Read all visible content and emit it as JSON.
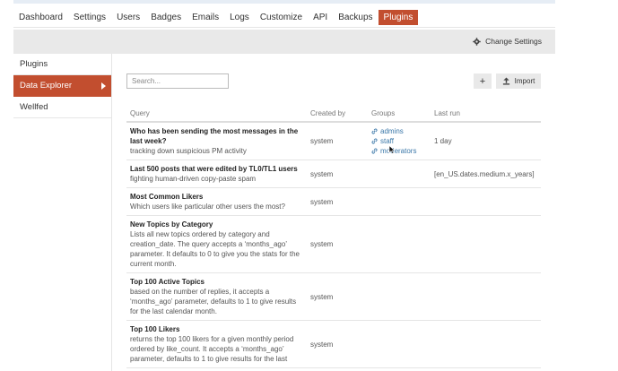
{
  "nav": {
    "items": [
      "Dashboard",
      "Settings",
      "Users",
      "Badges",
      "Emails",
      "Logs",
      "Customize",
      "API",
      "Backups",
      "Plugins"
    ],
    "active": "Plugins"
  },
  "settings_bar": {
    "change_settings_label": "Change Settings",
    "icon": "gear-icon"
  },
  "sidebar": {
    "items": [
      {
        "label": "Plugins",
        "active": false
      },
      {
        "label": "Data Explorer",
        "active": true
      },
      {
        "label": "Wellfed",
        "active": false
      }
    ]
  },
  "search": {
    "placeholder": "Search...",
    "value": ""
  },
  "buttons": {
    "add_label": "+",
    "import_label": "Import"
  },
  "table": {
    "headers": {
      "query": "Query",
      "created_by": "Created by",
      "groups": "Groups",
      "last_run": "Last run"
    },
    "rows": [
      {
        "name": "Who has been sending the most messages in the last week?",
        "description": "tracking down suspicious PM activity",
        "created_by": "system",
        "groups": [
          "admins",
          "staff",
          "moderators"
        ],
        "last_run": "1 day"
      },
      {
        "name": "Last 500 posts that were edited by TL0/TL1 users",
        "description": "fighting human-driven copy-paste spam",
        "created_by": "system",
        "groups": [],
        "last_run": "[en_US.dates.medium.x_years]"
      },
      {
        "name": "Most Common Likers",
        "description": "Which users like particular other users the most?",
        "created_by": "system",
        "groups": [],
        "last_run": ""
      },
      {
        "name": "New Topics by Category",
        "description": "Lists all new topics ordered by category and creation_date. The query accepts a ‘months_ago’ parameter. It defaults to 0 to give you the stats for the current month.",
        "created_by": "system",
        "groups": [],
        "last_run": ""
      },
      {
        "name": "Top 100 Active Topics",
        "description": "based on the number of replies, it accepts a ‘months_ago’ parameter, defaults to 1 to give results for the last calendar month.",
        "created_by": "system",
        "groups": [],
        "last_run": ""
      },
      {
        "name": "Top 100 Likers",
        "description": "returns the top 100 likers for a given monthly period ordered by like_count. It accepts a ‘months_ago’ parameter, defaults to 1 to give results for the last",
        "created_by": "system",
        "groups": [],
        "last_run": ""
      }
    ]
  },
  "colors": {
    "accent": "#c24e2f",
    "link": "#3a77a8",
    "bar": "#e9e9e9"
  }
}
